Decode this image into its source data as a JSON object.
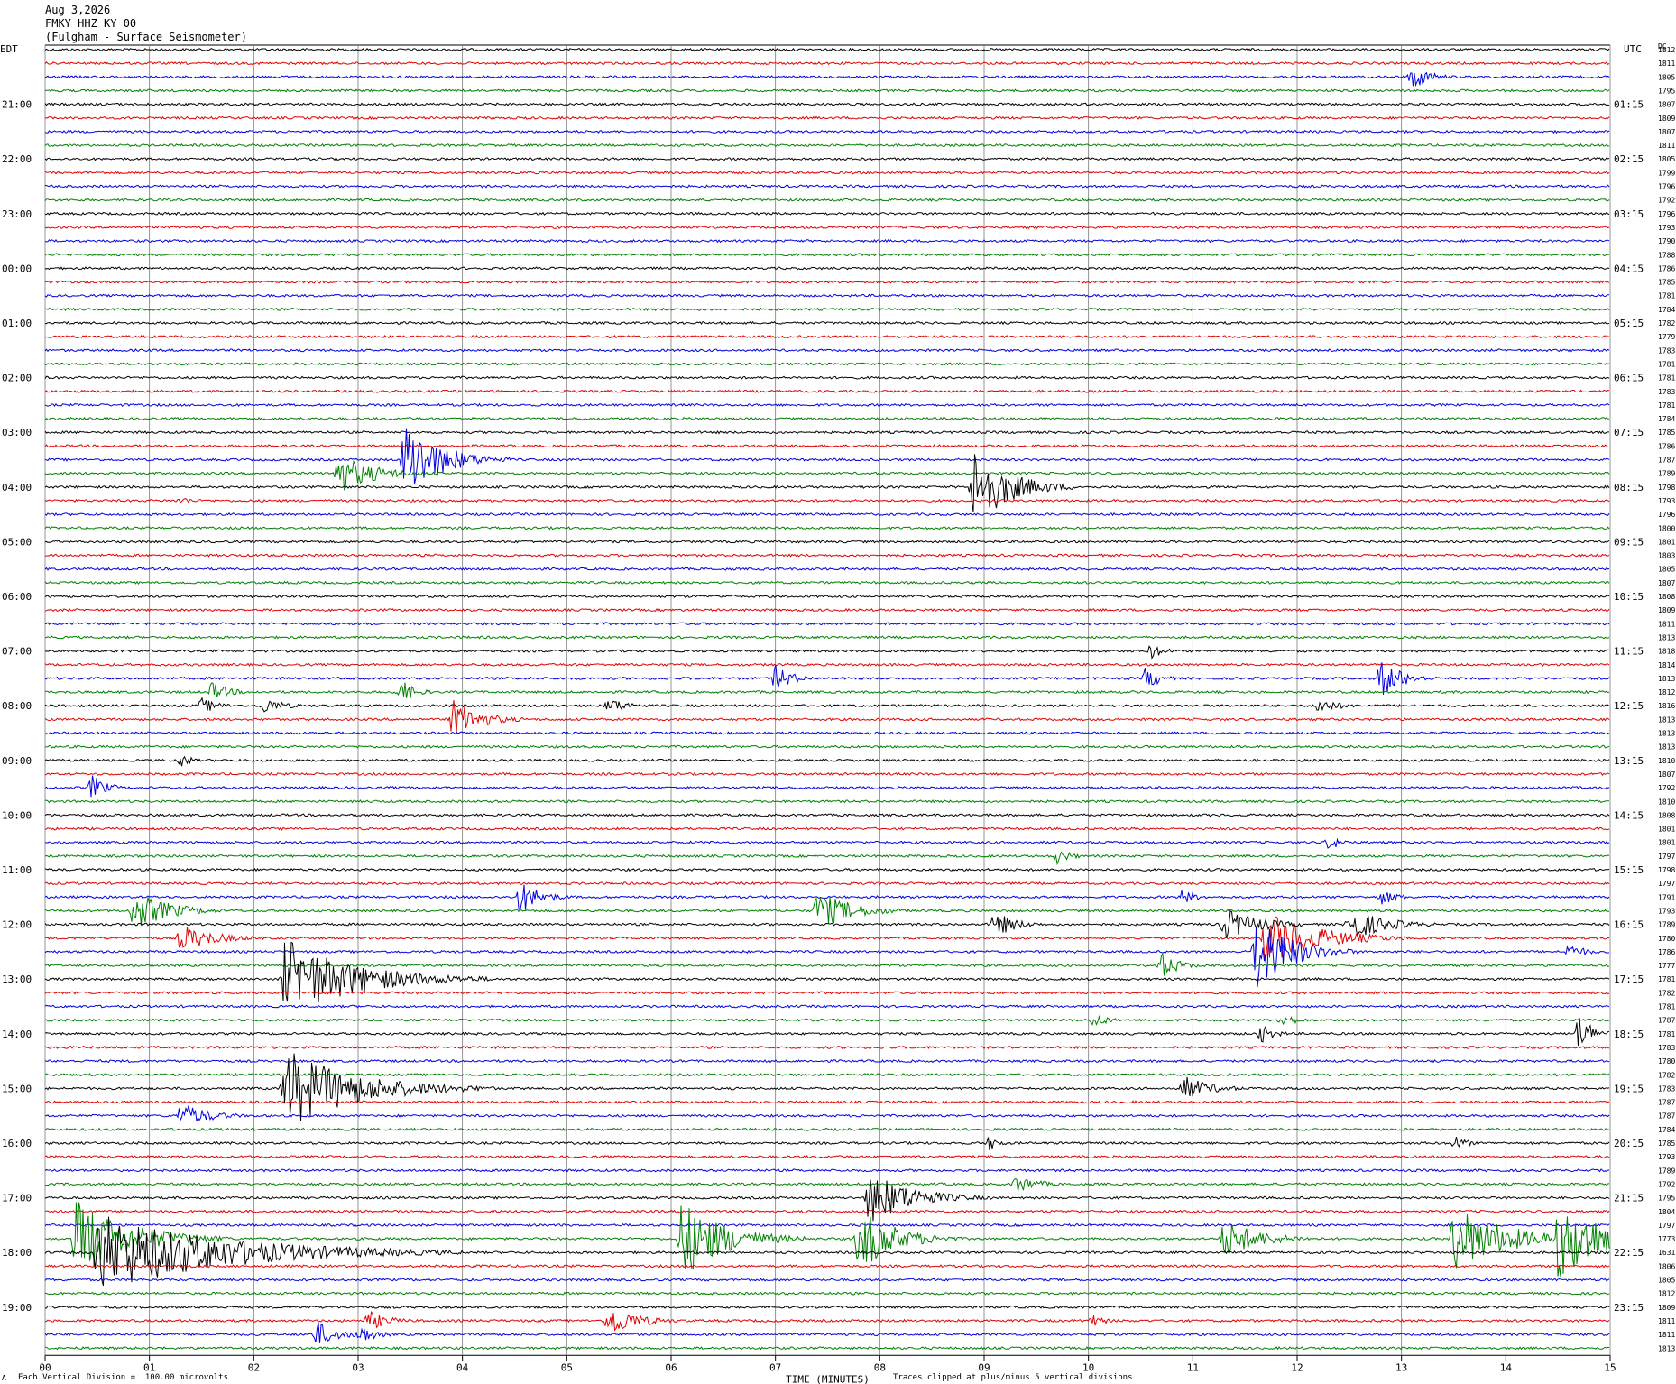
{
  "header": {
    "date": "Aug 3,2026",
    "station": "FMKY HHZ KY 00",
    "description": "(Fulgham - Surface Seismometer)"
  },
  "chart_data": {
    "type": "helicorder",
    "left_timezone": "EDT",
    "right_timezone": "UTC",
    "right_header": "DC",
    "xlabel": "TIME (MINUTES)",
    "xlim": [
      0,
      15
    ],
    "x_ticks": [
      "00",
      "01",
      "02",
      "03",
      "04",
      "05",
      "06",
      "07",
      "08",
      "09",
      "10",
      "11",
      "12",
      "13",
      "14",
      "15"
    ],
    "line_minutes": 15,
    "color_cycle": [
      "#000000",
      "#e00000",
      "#0000e0",
      "#008000"
    ],
    "left_hour_labels": [
      "21:00",
      "22:00",
      "23:00",
      "00:00",
      "01:00",
      "02:00",
      "03:00",
      "04:00",
      "05:00",
      "06:00",
      "07:00",
      "08:00",
      "09:00",
      "10:00",
      "11:00",
      "12:00",
      "13:00",
      "14:00",
      "15:00",
      "16:00",
      "17:00",
      "18:00",
      "19:00"
    ],
    "right_hour_labels": [
      "01:15",
      "02:15",
      "03:15",
      "04:15",
      "05:15",
      "06:15",
      "07:15",
      "08:15",
      "09:15",
      "10:15",
      "11:15",
      "12:15",
      "13:15",
      "14:15",
      "15:15",
      "16:15",
      "17:15",
      "18:15",
      "19:15",
      "20:15",
      "21:15",
      "22:15",
      "23:15"
    ],
    "dc_offsets": [
      "1812",
      "1811",
      "1805",
      "1795",
      "1807",
      "1809",
      "1807",
      "1811",
      "1805",
      "1799",
      "1796",
      "1792",
      "1796",
      "1793",
      "1790",
      "1788",
      "1786",
      "1785",
      "1781",
      "1784",
      "1782",
      "1779",
      "1783",
      "1781",
      "1781",
      "1783",
      "1781",
      "1784",
      "1785",
      "1786",
      "1787",
      "1789",
      "1798",
      "1793",
      "1796",
      "1800",
      "1801",
      "1803",
      "1805",
      "1807",
      "1808",
      "1809",
      "1811",
      "1813",
      "1818",
      "1814",
      "1813",
      "1812",
      "1816",
      "1813",
      "1813",
      "1813",
      "1810",
      "1807",
      "1792",
      "1810",
      "1808",
      "1801",
      "1801",
      "1797",
      "1798",
      "1797",
      "1791",
      "1793",
      "1789",
      "1780",
      "1786",
      "1777",
      "1781",
      "1782",
      "1781",
      "1787",
      "1781",
      "1783",
      "1780",
      "1782",
      "1783",
      "1787",
      "1787",
      "1784",
      "1785",
      "1793",
      "1789",
      "1792",
      "1795",
      "1804",
      "1797",
      "1773",
      "1631",
      "1806",
      "1805",
      "1812",
      "1809",
      "1811",
      "1811",
      "1813"
    ],
    "events": [
      {
        "line": 2,
        "minute": 13.1,
        "amplitude": 2.0,
        "duration": 0.5
      },
      {
        "line": 30,
        "minute": 3.45,
        "amplitude": 6.0,
        "duration": 1.0
      },
      {
        "line": 31,
        "minute": 2.8,
        "amplitude": 3.0,
        "duration": 1.0
      },
      {
        "line": 32,
        "minute": 8.9,
        "amplitude": 6.0,
        "duration": 1.0
      },
      {
        "line": 33,
        "minute": 1.3,
        "amplitude": 0.6,
        "duration": 0.4
      },
      {
        "line": 44,
        "minute": 10.6,
        "amplitude": 1.2,
        "duration": 0.4
      },
      {
        "line": 46,
        "minute": 7.0,
        "amplitude": 2.0,
        "duration": 0.5
      },
      {
        "line": 46,
        "minute": 10.55,
        "amplitude": 1.8,
        "duration": 0.4
      },
      {
        "line": 46,
        "minute": 12.8,
        "amplitude": 3.0,
        "duration": 0.6
      },
      {
        "line": 47,
        "minute": 1.6,
        "amplitude": 1.5,
        "duration": 0.5
      },
      {
        "line": 47,
        "minute": 3.4,
        "amplitude": 2.0,
        "duration": 0.4
      },
      {
        "line": 48,
        "minute": 1.5,
        "amplitude": 1.2,
        "duration": 0.5
      },
      {
        "line": 48,
        "minute": 2.1,
        "amplitude": 1.2,
        "duration": 0.6
      },
      {
        "line": 48,
        "minute": 5.4,
        "amplitude": 1.2,
        "duration": 0.6
      },
      {
        "line": 48,
        "minute": 12.2,
        "amplitude": 1.2,
        "duration": 0.6
      },
      {
        "line": 49,
        "minute": 3.9,
        "amplitude": 3.0,
        "duration": 0.8
      },
      {
        "line": 52,
        "minute": 1.3,
        "amplitude": 1.2,
        "duration": 0.3
      },
      {
        "line": 54,
        "minute": 0.45,
        "amplitude": 2.0,
        "duration": 0.4
      },
      {
        "line": 58,
        "minute": 12.3,
        "amplitude": 1.2,
        "duration": 0.4
      },
      {
        "line": 59,
        "minute": 9.7,
        "amplitude": 1.2,
        "duration": 0.4
      },
      {
        "line": 62,
        "minute": 4.55,
        "amplitude": 2.5,
        "duration": 0.6
      },
      {
        "line": 62,
        "minute": 10.9,
        "amplitude": 1.2,
        "duration": 0.4
      },
      {
        "line": 62,
        "minute": 12.8,
        "amplitude": 1.2,
        "duration": 0.5
      },
      {
        "line": 63,
        "minute": 0.85,
        "amplitude": 3.0,
        "duration": 1.0
      },
      {
        "line": 63,
        "minute": 7.4,
        "amplitude": 3.0,
        "duration": 1.0
      },
      {
        "line": 64,
        "minute": 9.1,
        "amplitude": 2.0,
        "duration": 0.6
      },
      {
        "line": 64,
        "minute": 11.3,
        "amplitude": 2.5,
        "duration": 1.0
      },
      {
        "line": 64,
        "minute": 12.5,
        "amplitude": 2.5,
        "duration": 1.0
      },
      {
        "line": 65,
        "minute": 1.3,
        "amplitude": 2.0,
        "duration": 1.0
      },
      {
        "line": 65,
        "minute": 11.7,
        "amplitude": 4.0,
        "duration": 1.5
      },
      {
        "line": 66,
        "minute": 11.6,
        "amplitude": 6.0,
        "duration": 1.0
      },
      {
        "line": 66,
        "minute": 14.6,
        "amplitude": 1.2,
        "duration": 0.5
      },
      {
        "line": 67,
        "minute": 10.7,
        "amplitude": 2.0,
        "duration": 0.5
      },
      {
        "line": 68,
        "minute": 2.3,
        "amplitude": 6.0,
        "duration": 2.0
      },
      {
        "line": 71,
        "minute": 10.05,
        "amplitude": 1.2,
        "duration": 0.4
      },
      {
        "line": 71,
        "minute": 11.85,
        "amplitude": 1.2,
        "duration": 0.4
      },
      {
        "line": 72,
        "minute": 11.65,
        "amplitude": 1.5,
        "duration": 0.4
      },
      {
        "line": 72,
        "minute": 14.7,
        "amplitude": 3.0,
        "duration": 0.4
      },
      {
        "line": 76,
        "minute": 2.3,
        "amplitude": 6.0,
        "duration": 2.0
      },
      {
        "line": 76,
        "minute": 10.9,
        "amplitude": 2.0,
        "duration": 0.8
      },
      {
        "line": 78,
        "minute": 1.3,
        "amplitude": 2.0,
        "duration": 0.8
      },
      {
        "line": 80,
        "minute": 9.05,
        "amplitude": 1.2,
        "duration": 0.3
      },
      {
        "line": 80,
        "minute": 13.5,
        "amplitude": 1.2,
        "duration": 0.4
      },
      {
        "line": 83,
        "minute": 9.3,
        "amplitude": 1.5,
        "duration": 0.6
      },
      {
        "line": 84,
        "minute": 7.9,
        "amplitude": 4.0,
        "duration": 1.2
      },
      {
        "line": 87,
        "minute": 0.3,
        "amplitude": 6.0,
        "duration": 1.5
      },
      {
        "line": 87,
        "minute": 6.1,
        "amplitude": 6.0,
        "duration": 1.2
      },
      {
        "line": 87,
        "minute": 7.8,
        "amplitude": 5.0,
        "duration": 1.0
      },
      {
        "line": 87,
        "minute": 11.3,
        "amplitude": 3.0,
        "duration": 1.0
      },
      {
        "line": 87,
        "minute": 13.5,
        "amplitude": 5.0,
        "duration": 1.5
      },
      {
        "line": 87,
        "minute": 14.5,
        "amplitude": 6.0,
        "duration": 1.5
      },
      {
        "line": 88,
        "minute": 0.5,
        "amplitude": 6.0,
        "duration": 3.5
      },
      {
        "line": 93,
        "minute": 5.4,
        "amplitude": 2.5,
        "duration": 0.8
      },
      {
        "line": 93,
        "minute": 3.1,
        "amplitude": 1.5,
        "duration": 0.6
      },
      {
        "line": 93,
        "minute": 10.0,
        "amplitude": 1.2,
        "duration": 0.4
      },
      {
        "line": 94,
        "minute": 2.6,
        "amplitude": 2.0,
        "duration": 0.6
      },
      {
        "line": 94,
        "minute": 3.0,
        "amplitude": 1.5,
        "duration": 0.5
      }
    ]
  },
  "footer": {
    "scale_note": "Each Vertical Division =  100.00 microvolts",
    "clip_note": "Traces clipped at plus/minus 5 vertical divisions",
    "corner_mark": "A"
  }
}
